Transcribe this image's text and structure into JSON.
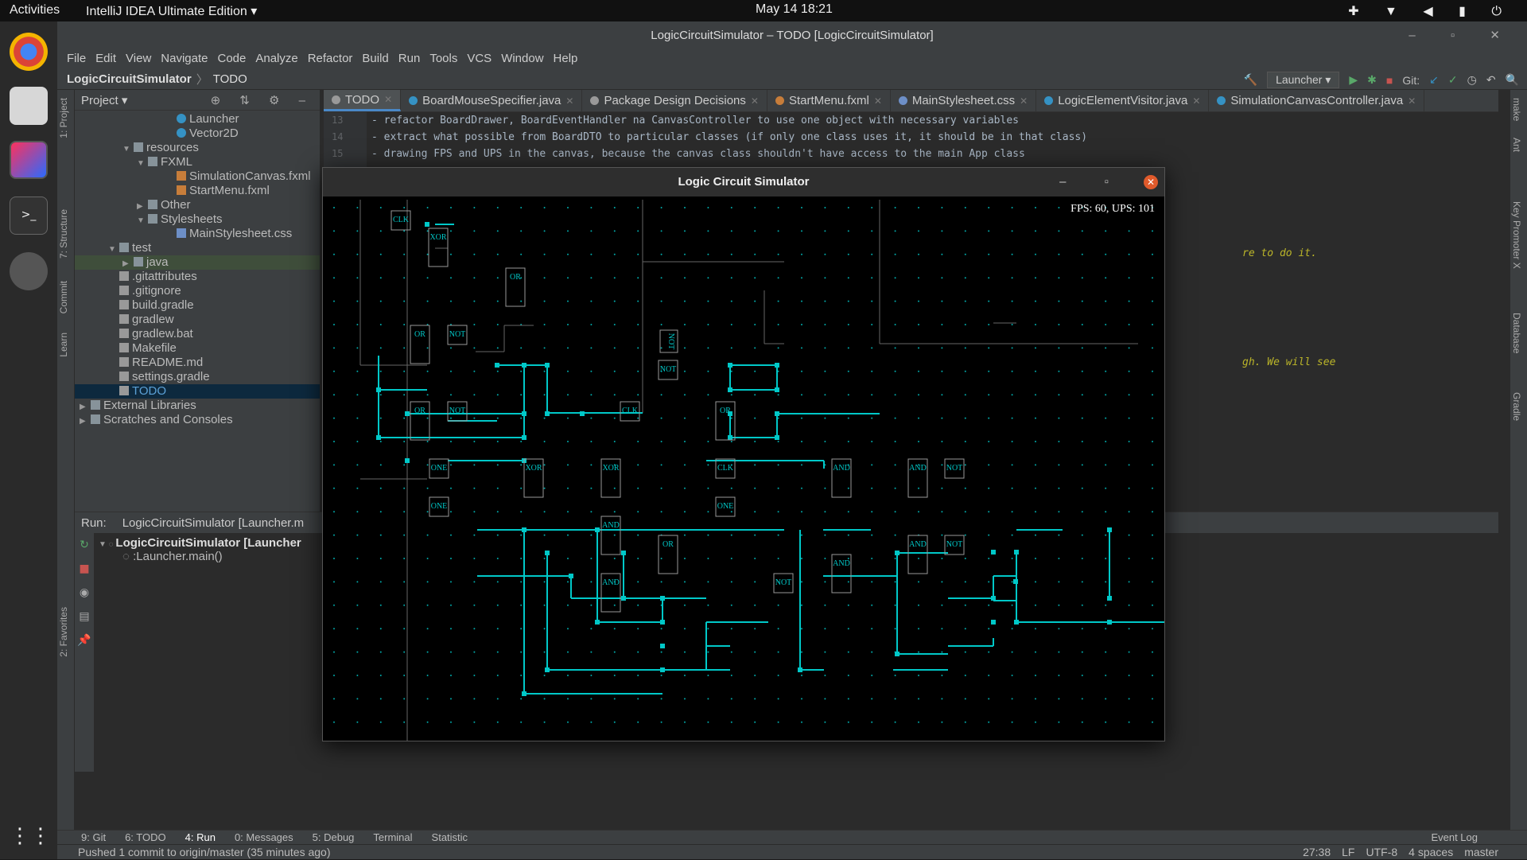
{
  "os": {
    "activities": "Activities",
    "app_name": "IntelliJ IDEA Ultimate Edition ▾",
    "clock": "May 14  18:21"
  },
  "window": {
    "title": "LogicCircuitSimulator – TODO [LogicCircuitSimulator]"
  },
  "menu": [
    "File",
    "Edit",
    "View",
    "Navigate",
    "Code",
    "Analyze",
    "Refactor",
    "Build",
    "Run",
    "Tools",
    "VCS",
    "Window",
    "Help"
  ],
  "nav": {
    "project": "LogicCircuitSimulator",
    "file": "TODO",
    "run_config": "Launcher ▾",
    "git_label": "Git:"
  },
  "project_panel": {
    "title": "Project ▾"
  },
  "tree": [
    {
      "label": "Launcher",
      "indent": 6,
      "icon": "cls",
      "arrow": ""
    },
    {
      "label": "Vector2D",
      "indent": 6,
      "icon": "cls",
      "arrow": ""
    },
    {
      "label": "resources",
      "indent": 3,
      "icon": "folder",
      "arrow": "▼"
    },
    {
      "label": "FXML",
      "indent": 4,
      "icon": "folder",
      "arrow": "▼"
    },
    {
      "label": "SimulationCanvas.fxml",
      "indent": 6,
      "icon": "fxml",
      "arrow": ""
    },
    {
      "label": "StartMenu.fxml",
      "indent": 6,
      "icon": "fxml",
      "arrow": ""
    },
    {
      "label": "Other",
      "indent": 4,
      "icon": "folder",
      "arrow": "▶"
    },
    {
      "label": "Stylesheets",
      "indent": 4,
      "icon": "folder",
      "arrow": "▼"
    },
    {
      "label": "MainStylesheet.css",
      "indent": 6,
      "icon": "css",
      "arrow": ""
    },
    {
      "label": "test",
      "indent": 2,
      "icon": "folder",
      "arrow": "▼"
    },
    {
      "label": "java",
      "indent": 3,
      "icon": "folder",
      "arrow": "▶",
      "hl": true
    },
    {
      "label": ".gitattributes",
      "indent": 2,
      "icon": "txt",
      "arrow": ""
    },
    {
      "label": ".gitignore",
      "indent": 2,
      "icon": "txt",
      "arrow": ""
    },
    {
      "label": "build.gradle",
      "indent": 2,
      "icon": "txt",
      "arrow": ""
    },
    {
      "label": "gradlew",
      "indent": 2,
      "icon": "txt",
      "arrow": ""
    },
    {
      "label": "gradlew.bat",
      "indent": 2,
      "icon": "txt",
      "arrow": ""
    },
    {
      "label": "Makefile",
      "indent": 2,
      "icon": "txt",
      "arrow": ""
    },
    {
      "label": "README.md",
      "indent": 2,
      "icon": "txt",
      "arrow": ""
    },
    {
      "label": "settings.gradle",
      "indent": 2,
      "icon": "txt",
      "arrow": ""
    },
    {
      "label": "TODO",
      "indent": 2,
      "icon": "txt",
      "arrow": "",
      "sel": true
    },
    {
      "label": "External Libraries",
      "indent": 0,
      "icon": "folder",
      "arrow": "▶"
    },
    {
      "label": "Scratches and Consoles",
      "indent": 0,
      "icon": "folder",
      "arrow": "▶"
    }
  ],
  "tabs": [
    "TODO",
    "BoardMouseSpecifier.java",
    "Package Design Decisions",
    "StartMenu.fxml",
    "MainStylesheet.css",
    "LogicElementVisitor.java",
    "SimulationCanvasController.java"
  ],
  "editor": {
    "line_numbers": [
      "13",
      "14",
      "15"
    ],
    "lines": [
      "- refactor BoardDrawer, BoardEventHandler na CanvasController to use one object with necessary variables",
      "- extract what possible from BoardDTO to particular classes (if only one class uses it, it should be in that class)",
      "- drawing FPS and UPS in the canvas, because the canvas class shouldn't have access to the main App class"
    ],
    "frag1": "re to do it.",
    "frag2": "gh. We will see"
  },
  "run": {
    "label": "Run:",
    "tab": "LogicCircuitSimulator [Launcher.m",
    "root": "LogicCircuitSimulator [Launcher",
    "child": ":Launcher.main()"
  },
  "bottom_tools": [
    "9: Git",
    "6: TODO",
    "4: Run",
    "0: Messages",
    "5: Debug",
    "Terminal",
    "Statistic"
  ],
  "event_log": "Event Log",
  "status": {
    "message": "Pushed 1 commit to origin/master (35 minutes ago)",
    "position": "27:38",
    "line_sep": "LF",
    "encoding": "UTF-8",
    "indent": "4 spaces",
    "branch": "master"
  },
  "left_tools": [
    "1: Project",
    "7: Structure",
    "Commit",
    "Learn",
    "2: Favorites"
  ],
  "right_tools": [
    "make",
    "Ant",
    "Key Promoter X",
    "Database",
    "Gradle"
  ],
  "simulator": {
    "title": "Logic Circuit Simulator",
    "fps_text": "FPS: 60, UPS: 101",
    "wire_color": "#00c8c8",
    "gate_labels": [
      "CLK",
      "XOR",
      "OR",
      "OR",
      "NOT",
      "NOT",
      "NOT",
      "OR",
      "NOT",
      "CLK",
      "OR",
      "ONE",
      "XOR",
      "XOR",
      "ONE",
      "AND",
      "OR",
      "AND",
      "CLK",
      "ONE",
      "AND",
      "AND",
      "NOT",
      "NOT",
      "AND",
      "AND",
      "NOT"
    ]
  }
}
